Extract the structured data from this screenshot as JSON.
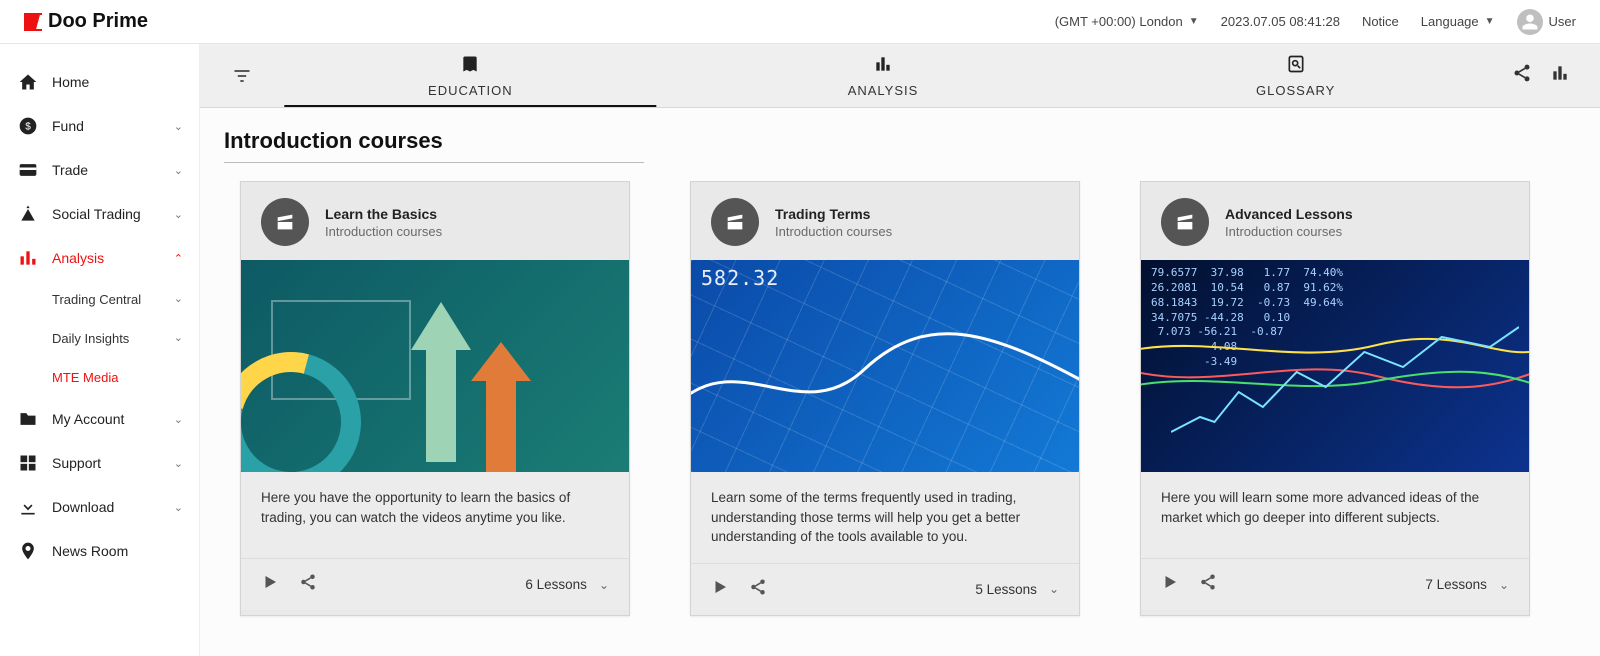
{
  "brand": "Doo Prime",
  "header": {
    "timezone": "(GMT +00:00) London",
    "datetime": "2023.07.05 08:41:28",
    "notice": "Notice",
    "language": "Language",
    "user": "User"
  },
  "sidebar": {
    "items": [
      {
        "label": "Home"
      },
      {
        "label": "Fund"
      },
      {
        "label": "Trade"
      },
      {
        "label": "Social Trading"
      },
      {
        "label": "Analysis"
      },
      {
        "label": "My Account"
      },
      {
        "label": "Support"
      },
      {
        "label": "Download"
      },
      {
        "label": "News Room"
      }
    ],
    "analysis_children": [
      {
        "label": "Trading Central"
      },
      {
        "label": "Daily Insights"
      },
      {
        "label": "MTE Media"
      }
    ]
  },
  "tabs": {
    "education": "EDUCATION",
    "analysis": "ANALYSIS",
    "glossary": "GLOSSARY"
  },
  "page_title": "Introduction courses",
  "cards": [
    {
      "title": "Learn the Basics",
      "subtitle": "Introduction courses",
      "description": "Here you have the opportunity to learn the basics of trading, you can watch the videos anytime you like.",
      "lessons": "6 Lessons"
    },
    {
      "title": "Trading Terms",
      "subtitle": "Introduction courses",
      "description": "Learn some of the terms frequently used in trading, understanding those terms will help you get a better understanding of the tools available to you.",
      "lessons": "5 Lessons",
      "overlay_number": "582.32"
    },
    {
      "title": "Advanced Lessons",
      "subtitle": "Introduction courses",
      "description": "Here you will learn some more advanced ideas of the market which go deeper into different subjects.",
      "lessons": "7 Lessons",
      "ticker_block": "79.6577  37.98   1.77  74.40%\n26.2081  10.54   0.87  91.62%\n68.1843  19.72  -0.73  49.64%\n34.7075 -44.28   0.10\n 7.073 -56.21  -0.87\n         4.08\n        -3.49"
    }
  ]
}
